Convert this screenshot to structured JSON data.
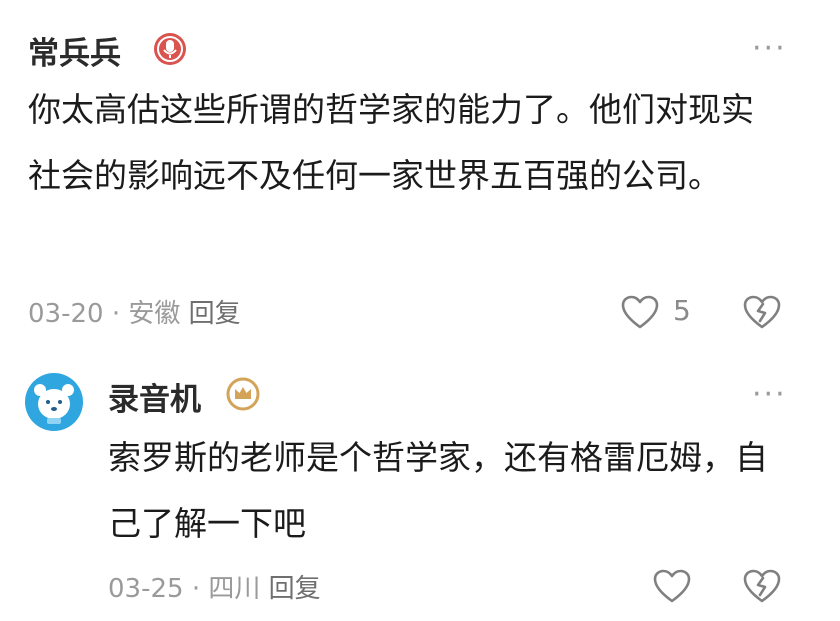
{
  "comments": [
    {
      "username": "常兵兵",
      "badge_icon": "microphone-badge-icon",
      "text": "你太高估这些所谓的哲学家的能力了。他们对现实社会的影响远不及任何一家世界五百强的公司。",
      "date": "03-20",
      "separator": "·",
      "location": "安徽",
      "reply_label": "回复",
      "like_count": "5",
      "more_label": "···"
    },
    {
      "username": "录音机",
      "badge_icon": "crown-badge-icon",
      "text": "索罗斯的老师是个哲学家，还有格雷厄姆，自己了解一下吧",
      "date": "03-25",
      "separator": "·",
      "location": "四川",
      "reply_label": "回复",
      "more_label": "···"
    }
  ],
  "colors": {
    "badge_red": "#d9534f",
    "badge_gold": "#d4a35a",
    "avatar_bg": "#2fa6e0",
    "meta_gray": "#9a9a9a"
  }
}
